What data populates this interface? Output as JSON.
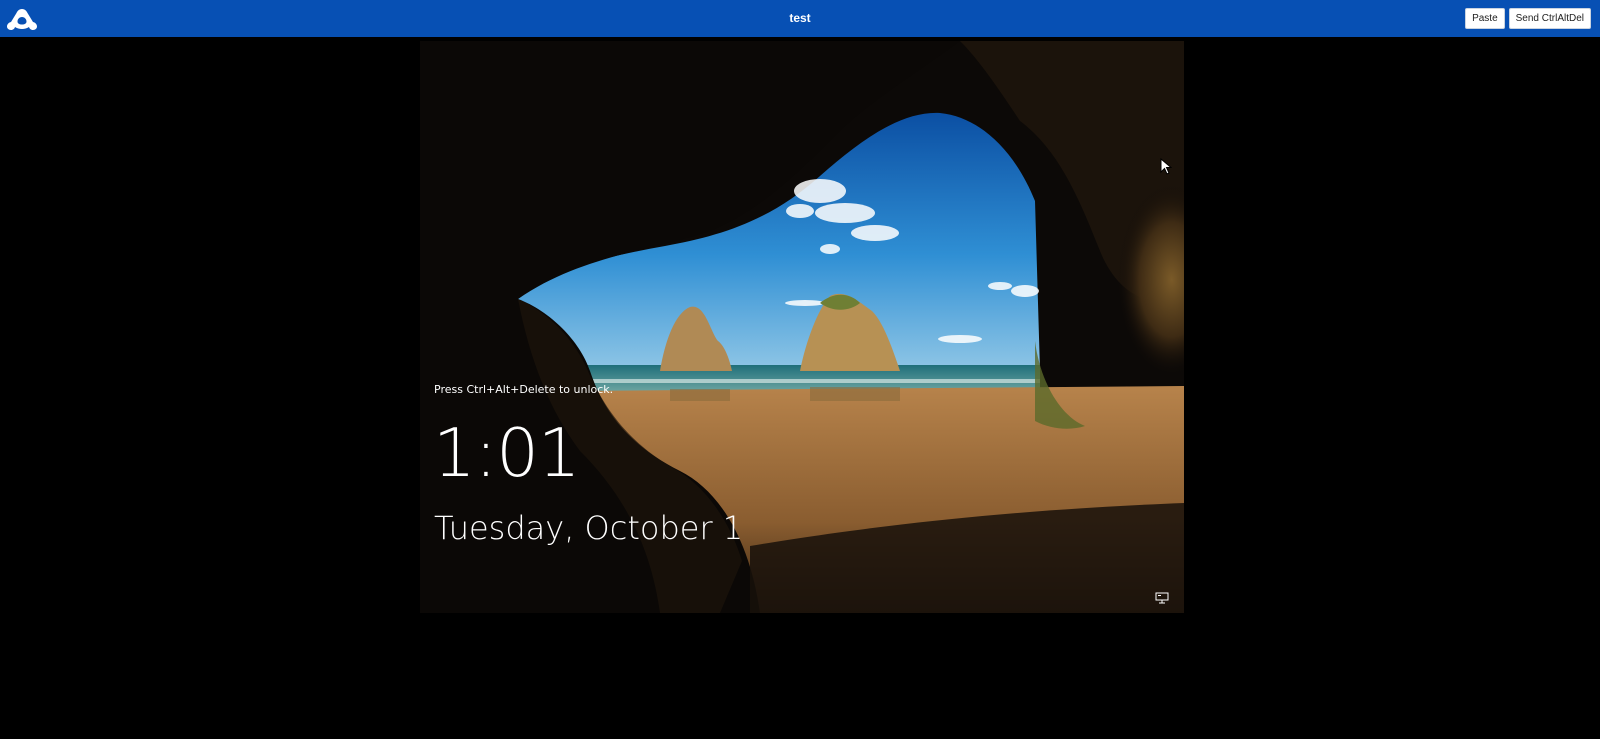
{
  "header": {
    "logo_icon": "app-logo-icon",
    "title": "test",
    "buttons": {
      "paste": "Paste",
      "send_ctrl_alt_del": "Send CtrlAltDel"
    }
  },
  "remote_screen": {
    "lock_hint": "Press Ctrl+Alt+Delete to unlock.",
    "time": "1:01",
    "date": "Tuesday, October 1",
    "network_icon": "network-icon",
    "cursor_icon": "mouse-cursor-icon"
  },
  "colors": {
    "header_bg": "#0750b4",
    "page_bg": "#000000"
  }
}
